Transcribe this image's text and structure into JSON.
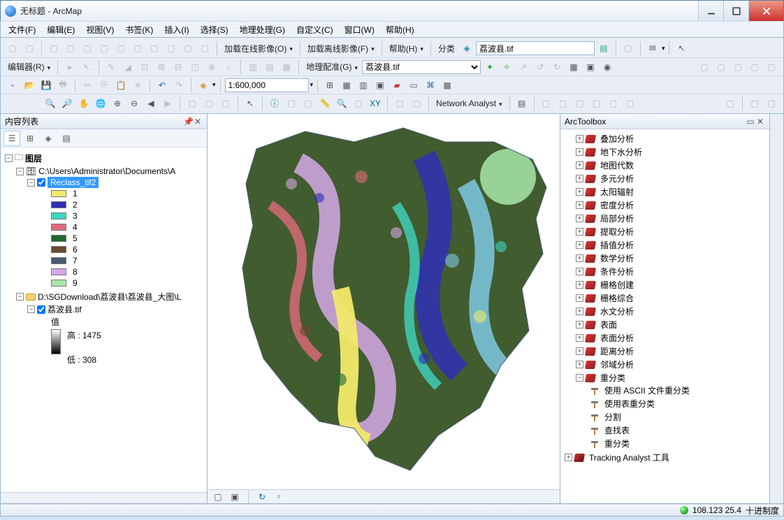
{
  "window": {
    "title": "无标题 - ArcMap"
  },
  "menu": {
    "file": "文件(F)",
    "edit": "编辑(E)",
    "view": "视图(V)",
    "bookmarks": "书签(K)",
    "insert": "插入(I)",
    "selection": "选择(S)",
    "geoprocessing": "地理处理(G)",
    "customize": "自定义(C)",
    "windows": "窗口(W)",
    "help": "帮助(H)"
  },
  "toolbars": {
    "load_online": "加载在线影像(O)",
    "load_offline": "加载离线影像(F)",
    "help_menu": "帮助(H)",
    "classify": "分类",
    "layer_combo": "荔波县.tif",
    "editor": "编辑器(R)",
    "georef": "地理配准(G)",
    "georef_target": "荔波县.tif",
    "scale": "1:600,000",
    "na": "Network Analyst"
  },
  "toc": {
    "title": "内容列表",
    "root": "图层",
    "dataframe_path": "C:\\Users\\Administrator\\Documents\\A",
    "layer1": {
      "name": "Reclass_tif2",
      "classes": [
        {
          "v": "1",
          "c": "#f2e96a"
        },
        {
          "v": "2",
          "c": "#2f2fb5"
        },
        {
          "v": "3",
          "c": "#3fd6c2"
        },
        {
          "v": "4",
          "c": "#e06a7a"
        },
        {
          "v": "5",
          "c": "#1f6b2f"
        },
        {
          "v": "6",
          "c": "#6b4a2f"
        },
        {
          "v": "7",
          "c": "#4a5a6f"
        },
        {
          "v": "8",
          "c": "#d6a8e6"
        },
        {
          "v": "9",
          "c": "#a8e6a8"
        }
      ]
    },
    "group2_path": "D:\\SGDownload\\荔波县\\荔波县_大图\\L",
    "layer2": {
      "name": "荔波县.tif",
      "value_label": "值",
      "high": "高 : 1475",
      "low": "低 : 308"
    }
  },
  "toolbox": {
    "title": "ArcToolbox",
    "toolsets": [
      "叠加分析",
      "地下水分析",
      "地图代数",
      "多元分析",
      "太阳辐射",
      "密度分析",
      "局部分析",
      "提取分析",
      "插值分析",
      "数学分析",
      "条件分析",
      "栅格创建",
      "栅格综合",
      "水文分析",
      "表面",
      "表面分析",
      "距离分析",
      "邻域分析"
    ],
    "reclass_set": "重分类",
    "reclass_tools": [
      "使用 ASCII 文件重分类",
      "使用表重分类",
      "分割",
      "查找表",
      "重分类"
    ],
    "tracking": "Tracking Analyst 工具"
  },
  "status": {
    "coords": "108.123  25.4",
    "units": "十进制度"
  }
}
